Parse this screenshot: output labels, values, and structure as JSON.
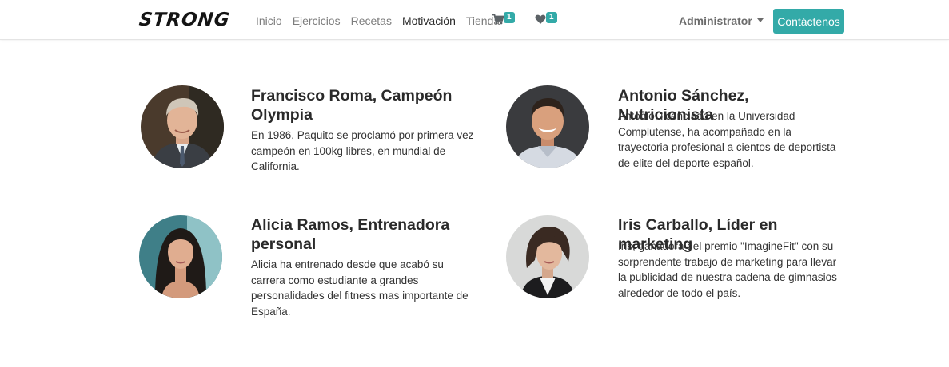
{
  "brand": {
    "logo_text": "STRONG"
  },
  "nav": {
    "links": [
      {
        "label": "Inicio"
      },
      {
        "label": "Ejercicios"
      },
      {
        "label": "Recetas"
      },
      {
        "label": "Motivación",
        "active": true
      },
      {
        "label": "Tienda"
      }
    ],
    "cart": {
      "icon": "cart-icon",
      "count": "1"
    },
    "favorites": {
      "icon": "heart-icon",
      "count": "1"
    },
    "user_menu": {
      "label": "Administrator"
    },
    "contact_label": "Contáctenos"
  },
  "colors": {
    "accent": "#33aaa8",
    "text": "#212529",
    "nav_text": "#7d7d7d"
  },
  "team": [
    {
      "name": "Francisco Roma, Campeón Olympia",
      "description": "En 1986, Paquito se proclamó por primera vez campeón en 100kg libres, en mundial de California."
    },
    {
      "name": "Antonio Sánchez, Nutricionista",
      "description": "Antonio, licenciado en la Universidad Complutense, ha acompañado en la trayectoria profesional a cientos de deportista de elite del deporte español."
    },
    {
      "name": "Alicia Ramos, Entrenadora personal",
      "description": "Alicia ha entrenado desde que acabó su carrera como estudiante a grandes personalidades del fitness mas importante de España."
    },
    {
      "name": "Iris Carballo, Líder en marketing",
      "description": "Iris, ganadora del premio \"ImagineFit\" con su sorprendente trabajo de marketing para llevar la publicidad de nuestra cadena de gimnasios alrededor de todo el país."
    }
  ]
}
